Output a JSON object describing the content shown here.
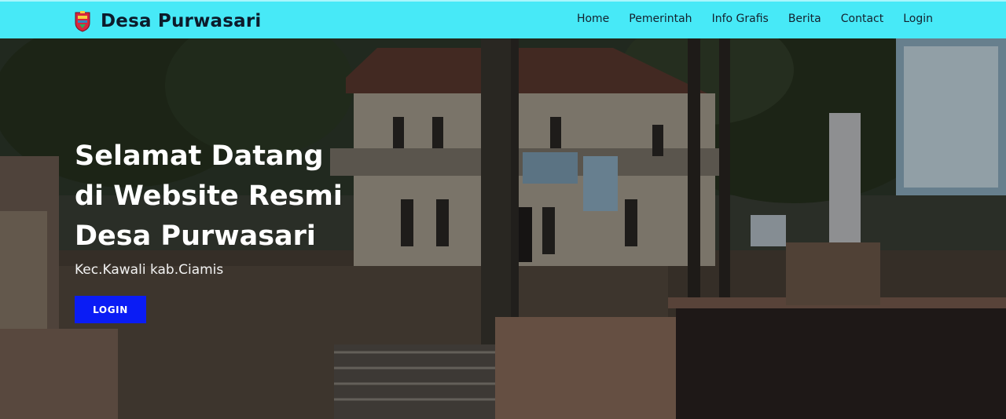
{
  "brand": {
    "name": "Desa Purwasari",
    "logo_icon": "village-emblem-icon"
  },
  "nav": [
    {
      "label": "Home"
    },
    {
      "label": "Pemerintah"
    },
    {
      "label": "Info Grafis"
    },
    {
      "label": "Berita"
    },
    {
      "label": "Contact"
    },
    {
      "label": "Login"
    }
  ],
  "hero": {
    "title_line1": "Selamat Datang",
    "title_line2": "di Website Resmi",
    "title_line3": "Desa Purwasari",
    "subtitle": "Kec.Kawali kab.Ciamis",
    "button_label": "LOGIN"
  },
  "colors": {
    "navbar": "#47e9f7",
    "button": "#0a1cf5"
  }
}
